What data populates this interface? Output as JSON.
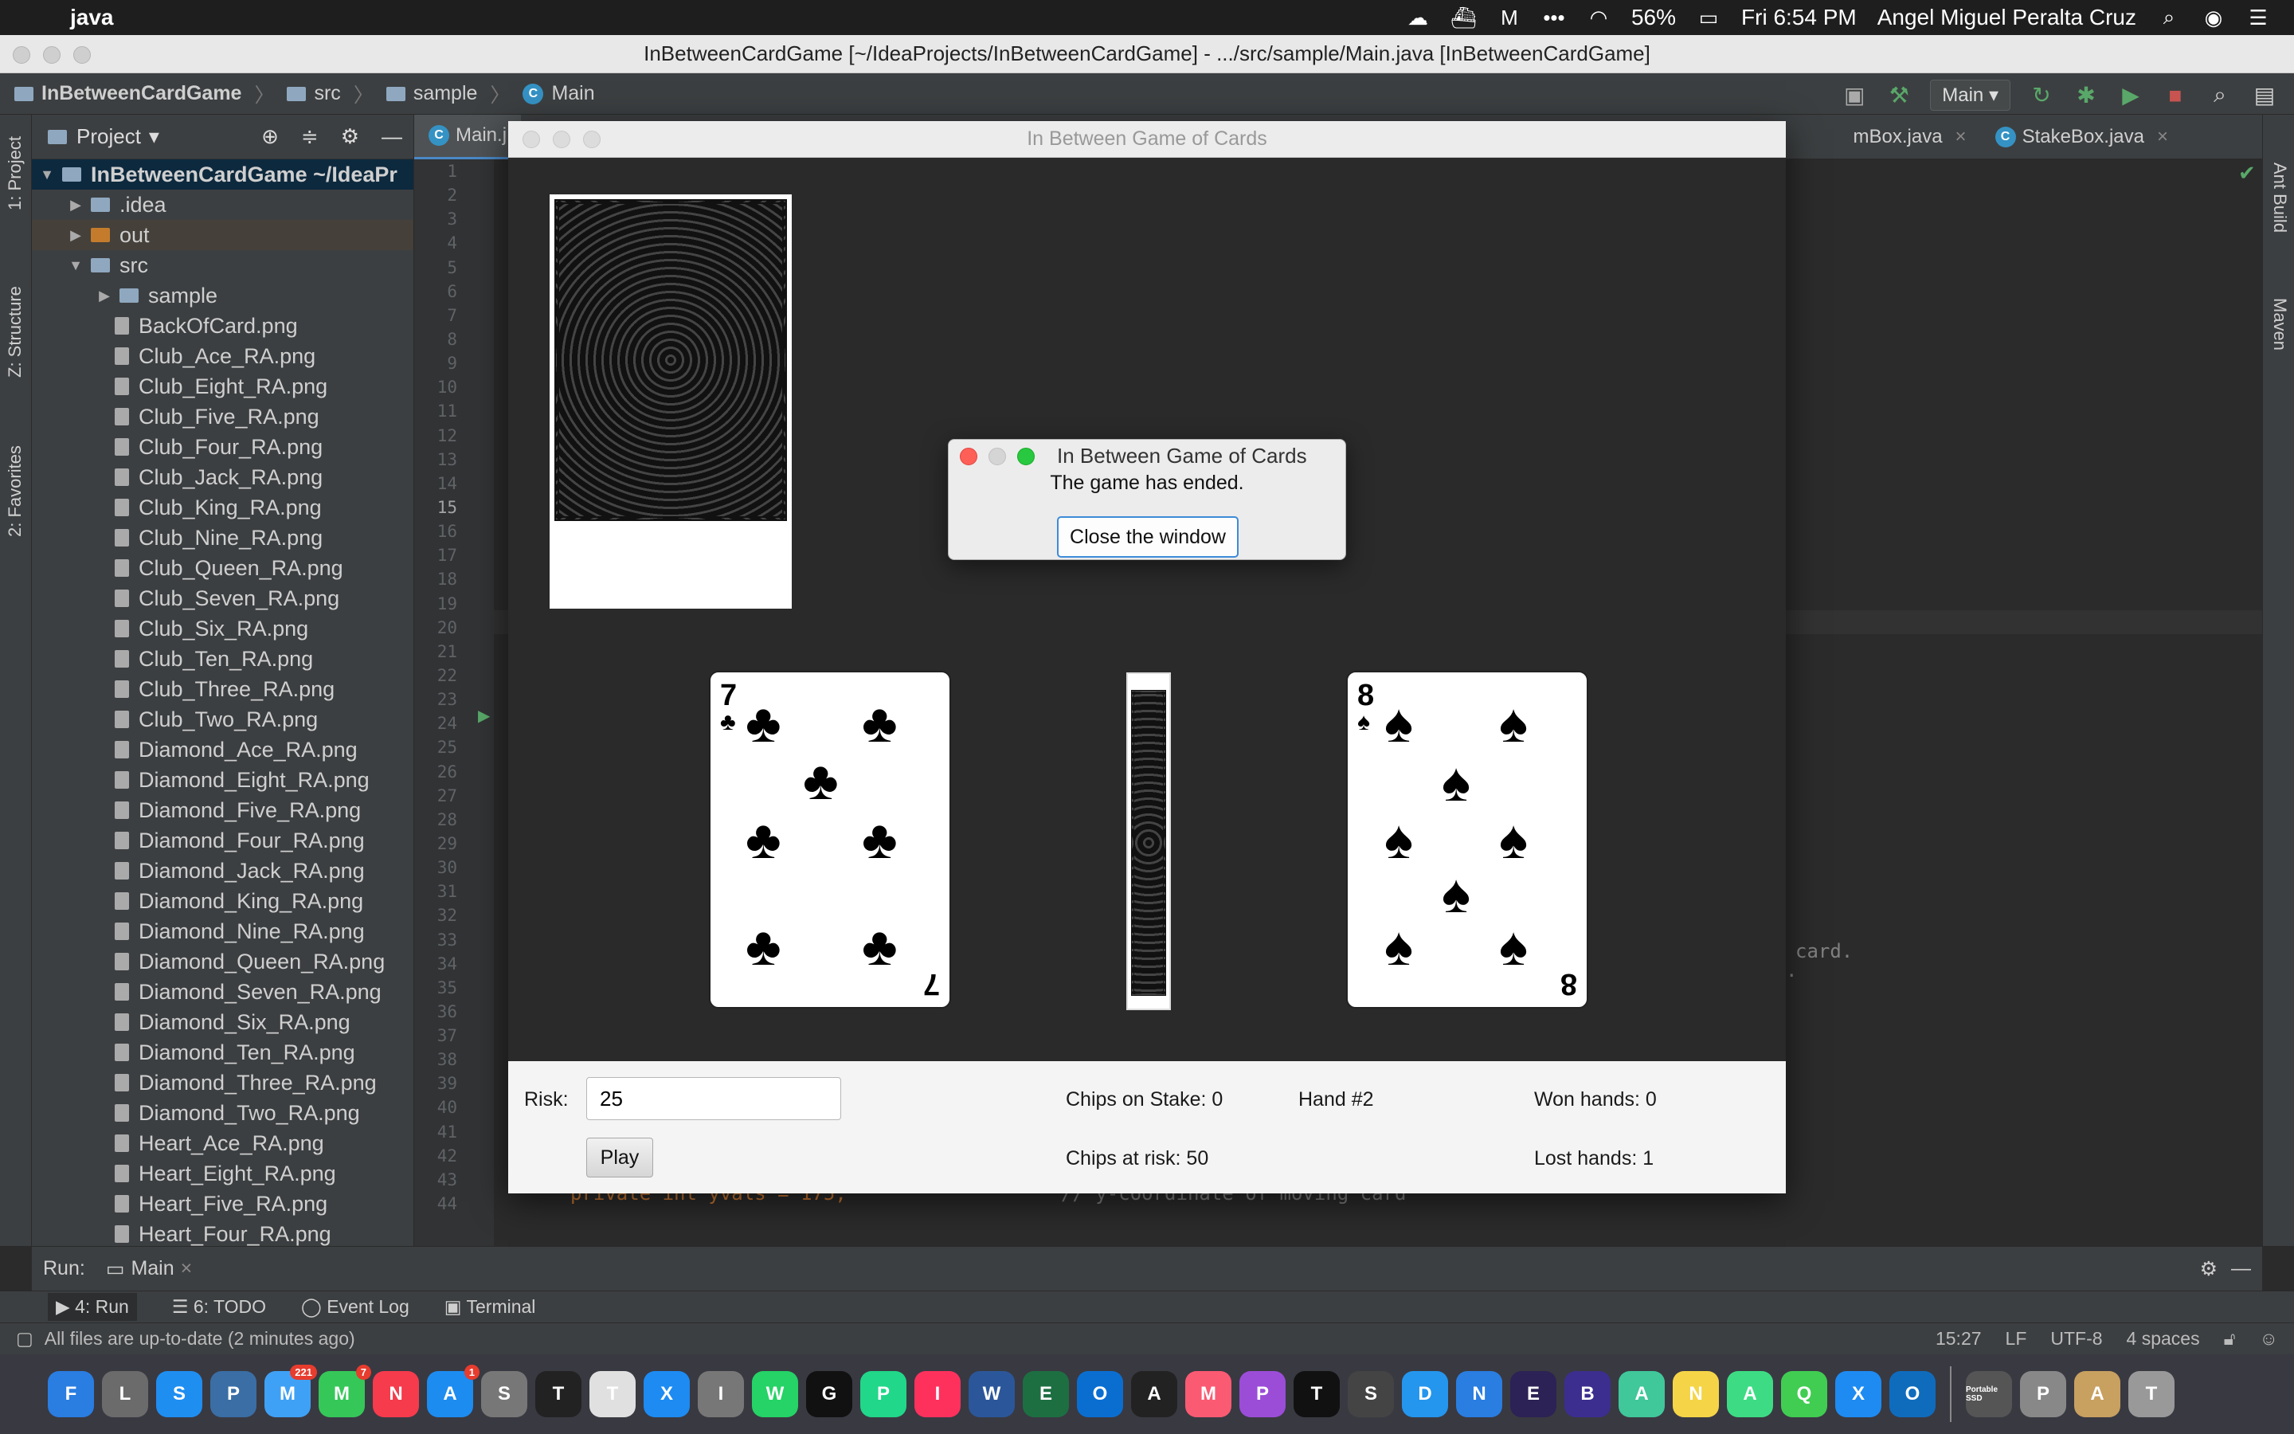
{
  "menubar": {
    "app": "java",
    "battery": "56%",
    "clock": "Fri 6:54 PM",
    "user": "Angel Miguel Peralta Cruz"
  },
  "ide": {
    "window_title": "InBetweenCardGame [~/IdeaProjects/InBetweenCardGame] - .../src/sample/Main.java [InBetweenCardGame]",
    "breadcrumb": [
      "InBetweenCardGame",
      "src",
      "sample",
      "Main"
    ],
    "run_config": "Main",
    "project_panel_title": "Project",
    "left_tabs": [
      "1: Project",
      "Z: Structure",
      "2: Favorites"
    ],
    "right_tabs": [
      "Ant Build",
      "Maven"
    ],
    "tree": [
      {
        "label": "InBetweenCardGame ~/IdeaPr",
        "depth": 0,
        "arrow": "▼",
        "kind": "module"
      },
      {
        "label": ".idea",
        "depth": 1,
        "arrow": "▶",
        "kind": "folder"
      },
      {
        "label": "out",
        "depth": 1,
        "arrow": "▶",
        "kind": "folder-orange"
      },
      {
        "label": "src",
        "depth": 1,
        "arrow": "▼",
        "kind": "folder"
      },
      {
        "label": "sample",
        "depth": 2,
        "arrow": "▶",
        "kind": "folder"
      },
      {
        "label": "BackOfCard.png",
        "depth": 2,
        "arrow": "",
        "kind": "file"
      },
      {
        "label": "Club_Ace_RA.png",
        "depth": 2,
        "arrow": "",
        "kind": "file"
      },
      {
        "label": "Club_Eight_RA.png",
        "depth": 2,
        "arrow": "",
        "kind": "file"
      },
      {
        "label": "Club_Five_RA.png",
        "depth": 2,
        "arrow": "",
        "kind": "file"
      },
      {
        "label": "Club_Four_RA.png",
        "depth": 2,
        "arrow": "",
        "kind": "file"
      },
      {
        "label": "Club_Jack_RA.png",
        "depth": 2,
        "arrow": "",
        "kind": "file"
      },
      {
        "label": "Club_King_RA.png",
        "depth": 2,
        "arrow": "",
        "kind": "file"
      },
      {
        "label": "Club_Nine_RA.png",
        "depth": 2,
        "arrow": "",
        "kind": "file"
      },
      {
        "label": "Club_Queen_RA.png",
        "depth": 2,
        "arrow": "",
        "kind": "file"
      },
      {
        "label": "Club_Seven_RA.png",
        "depth": 2,
        "arrow": "",
        "kind": "file"
      },
      {
        "label": "Club_Six_RA.png",
        "depth": 2,
        "arrow": "",
        "kind": "file"
      },
      {
        "label": "Club_Ten_RA.png",
        "depth": 2,
        "arrow": "",
        "kind": "file"
      },
      {
        "label": "Club_Three_RA.png",
        "depth": 2,
        "arrow": "",
        "kind": "file"
      },
      {
        "label": "Club_Two_RA.png",
        "depth": 2,
        "arrow": "",
        "kind": "file"
      },
      {
        "label": "Diamond_Ace_RA.png",
        "depth": 2,
        "arrow": "",
        "kind": "file"
      },
      {
        "label": "Diamond_Eight_RA.png",
        "depth": 2,
        "arrow": "",
        "kind": "file"
      },
      {
        "label": "Diamond_Five_RA.png",
        "depth": 2,
        "arrow": "",
        "kind": "file"
      },
      {
        "label": "Diamond_Four_RA.png",
        "depth": 2,
        "arrow": "",
        "kind": "file"
      },
      {
        "label": "Diamond_Jack_RA.png",
        "depth": 2,
        "arrow": "",
        "kind": "file"
      },
      {
        "label": "Diamond_King_RA.png",
        "depth": 2,
        "arrow": "",
        "kind": "file"
      },
      {
        "label": "Diamond_Nine_RA.png",
        "depth": 2,
        "arrow": "",
        "kind": "file"
      },
      {
        "label": "Diamond_Queen_RA.png",
        "depth": 2,
        "arrow": "",
        "kind": "file"
      },
      {
        "label": "Diamond_Seven_RA.png",
        "depth": 2,
        "arrow": "",
        "kind": "file"
      },
      {
        "label": "Diamond_Six_RA.png",
        "depth": 2,
        "arrow": "",
        "kind": "file"
      },
      {
        "label": "Diamond_Ten_RA.png",
        "depth": 2,
        "arrow": "",
        "kind": "file"
      },
      {
        "label": "Diamond_Three_RA.png",
        "depth": 2,
        "arrow": "",
        "kind": "file"
      },
      {
        "label": "Diamond_Two_RA.png",
        "depth": 2,
        "arrow": "",
        "kind": "file"
      },
      {
        "label": "Heart_Ace_RA.png",
        "depth": 2,
        "arrow": "",
        "kind": "file"
      },
      {
        "label": "Heart_Eight_RA.png",
        "depth": 2,
        "arrow": "",
        "kind": "file"
      },
      {
        "label": "Heart_Five_RA.png",
        "depth": 2,
        "arrow": "",
        "kind": "file"
      },
      {
        "label": "Heart_Four_RA.png",
        "depth": 2,
        "arrow": "",
        "kind": "file"
      }
    ],
    "editor_tabs": [
      {
        "label": "Main.j",
        "active": true
      },
      {
        "label": "mBox.java",
        "active": false
      },
      {
        "label": "StakeBox.java",
        "active": false
      }
    ],
    "line_numbers_start": 1,
    "line_numbers_end": 44,
    "current_line": 15,
    "code_fragments": {
      "card": "card.",
      "dot": ".",
      "bottom_line": "private int yvals = 175;",
      "bottom_comment": "// y-coordinate of moving card"
    },
    "run_bar": {
      "label": "Run:",
      "config": "Main"
    },
    "tool_windows": [
      "4: Run",
      "6: TODO",
      "Event Log",
      "Terminal"
    ],
    "status": {
      "message": "All files are up-to-date (2 minutes ago)",
      "position": "15:27",
      "line_sep": "LF",
      "encoding": "UTF-8",
      "indent": "4 spaces"
    }
  },
  "game": {
    "window_title": "In Between Game of Cards",
    "cards": {
      "left": {
        "rank": "7",
        "suit": "♣"
      },
      "right": {
        "rank": "8",
        "suit": "♠"
      }
    },
    "controls": {
      "risk_label": "Risk:",
      "risk_value": "25",
      "play_label": "Play",
      "chips_on_stake": "Chips on Stake: 0",
      "chips_at_risk": "Chips at risk: 50",
      "hand": "Hand #2",
      "won": "Won hands: 0",
      "lost": "Lost hands: 1"
    }
  },
  "dialog": {
    "title": "In Between Game of Cards",
    "message": "The game has ended.",
    "button": "Close the window"
  },
  "dock": {
    "mail_badge": "221",
    "messages_badge": "7",
    "appstore_badge": "1",
    "apps": [
      "Finder",
      "Launchpad",
      "Safari",
      "Preview",
      "Mail",
      "Messages",
      "News",
      "App Store",
      "System Preferences",
      "Terminal",
      "TextEdit",
      "Xcode",
      "Image Capture",
      "WhatsApp",
      "Grammarly",
      "PyCharm",
      "IntelliJ",
      "Word",
      "Excel",
      "OneDrive",
      "Activity Monitor",
      "Music",
      "Podcasts",
      "TV",
      "Scroll",
      "Docker",
      "Network",
      "Eclipse",
      "BBEdit",
      "Atom",
      "Notes",
      "Android Studio",
      "Qt Creator",
      "Xcode Tools",
      "Outlook",
      "Portable SSD",
      "Preview",
      "Archive",
      "Trash"
    ],
    "portable_ssd_label": "Portable SSD"
  }
}
